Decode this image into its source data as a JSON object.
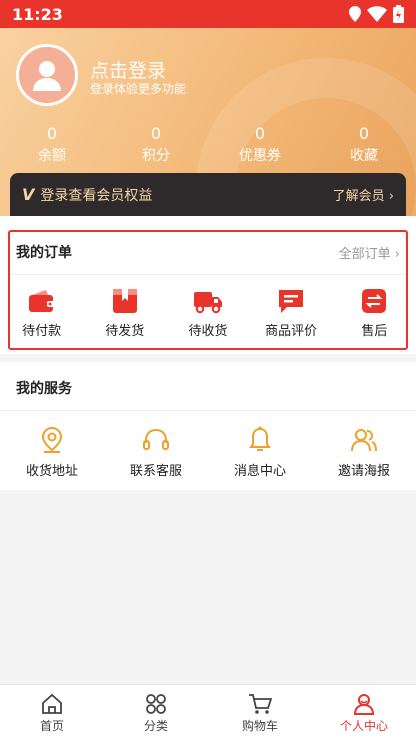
{
  "status_bar": {
    "time": "11:23"
  },
  "profile": {
    "login_title": "点击登录",
    "login_subtitle": "登录体验更多功能",
    "stats": [
      {
        "value": "0",
        "label": "余额"
      },
      {
        "value": "0",
        "label": "积分"
      },
      {
        "value": "0",
        "label": "优惠券"
      },
      {
        "value": "0",
        "label": "收藏"
      }
    ],
    "vip_banner": {
      "badge": "V",
      "text": "登录查看会员权益",
      "link": "了解会员"
    }
  },
  "orders": {
    "title": "我的订单",
    "all_link": "全部订单",
    "items": [
      {
        "label": "待付款",
        "icon": "wallet-icon"
      },
      {
        "label": "待发货",
        "icon": "package-icon"
      },
      {
        "label": "待收货",
        "icon": "truck-icon"
      },
      {
        "label": "商品评价",
        "icon": "comment-icon"
      },
      {
        "label": "售后",
        "icon": "exchange-icon"
      }
    ]
  },
  "services": {
    "title": "我的服务",
    "items": [
      {
        "label": "收货地址",
        "icon": "location-icon"
      },
      {
        "label": "联系客服",
        "icon": "headset-icon"
      },
      {
        "label": "消息中心",
        "icon": "bell-icon"
      },
      {
        "label": "邀请海报",
        "icon": "users-icon"
      }
    ]
  },
  "tab_bar": {
    "items": [
      {
        "label": "首页",
        "icon": "home-icon"
      },
      {
        "label": "分类",
        "icon": "grid-icon"
      },
      {
        "label": "购物车",
        "icon": "cart-icon"
      },
      {
        "label": "个人中心",
        "icon": "user-icon"
      }
    ],
    "active": "个人中心"
  },
  "colors": {
    "accent": "#e8342b",
    "service_icon": "#f0a02a",
    "banner_gold": "#f5d6a8"
  }
}
